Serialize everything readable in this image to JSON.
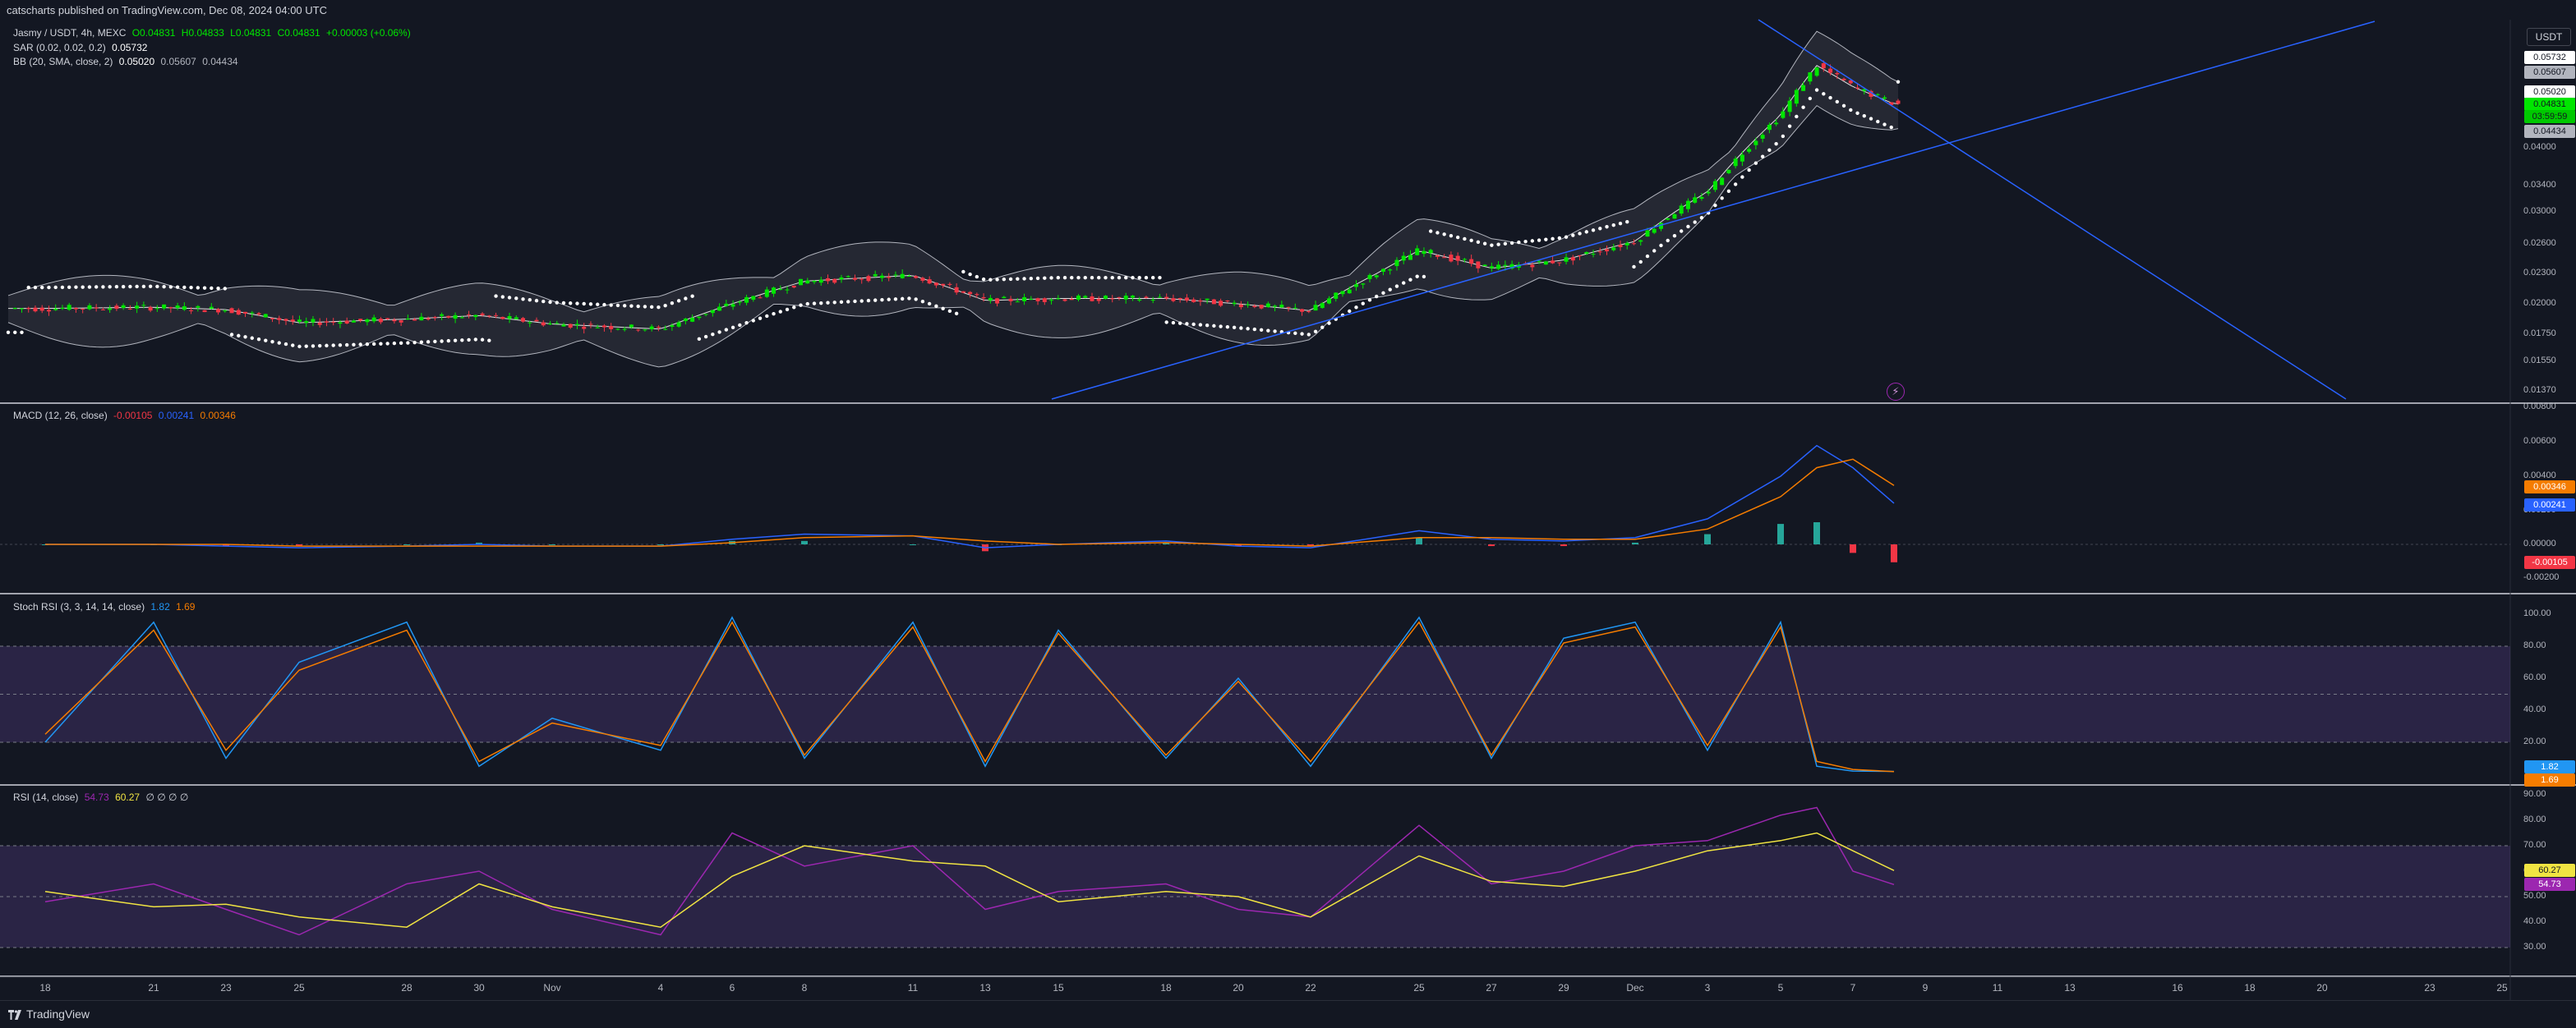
{
  "header": {
    "published": "catscharts published on TradingView.com, Dec 08, 2024 04:00 UTC"
  },
  "legend": {
    "main": {
      "symbol": "Jasmy / USDT, 4h, MEXC",
      "o": "O0.04831",
      "h": "H0.04833",
      "l": "L0.04831",
      "c": "C0.04831",
      "chg": "+0.00003 (+0.06%)"
    },
    "sar": {
      "name": "SAR (0.02, 0.02, 0.2)",
      "value": "0.05732"
    },
    "bb": {
      "name": "BB (20, SMA, close, 2)",
      "basis": "0.05020",
      "upper": "0.05607",
      "lower": "0.04434"
    },
    "macd": {
      "name": "MACD (12, 26, close)",
      "hist": "-0.00105",
      "macd": "0.00241",
      "signal": "0.00346"
    },
    "stoch": {
      "name": "Stoch RSI (3, 3, 14, 14, close)",
      "k": "1.82",
      "d": "1.69"
    },
    "rsi": {
      "name": "RSI (14, close)",
      "rsi": "54.73",
      "ma": "60.27",
      "extra": "∅ ∅ ∅ ∅"
    }
  },
  "axis": {
    "currency": "USDT",
    "price_ticks": [
      "0.04000",
      "0.03400",
      "0.03000",
      "0.02600",
      "0.02300",
      "0.02000",
      "0.01750",
      "0.01550",
      "0.01370"
    ],
    "price_tags": [
      {
        "text": "0.05732",
        "bg": "#ffffff",
        "fg": "#131722"
      },
      {
        "text": "0.05607",
        "bg": "#b2b5be",
        "fg": "#131722"
      },
      {
        "text": "0.05020",
        "bg": "#ffffff",
        "fg": "#131722"
      },
      {
        "text": "0.04831",
        "bg": "#00e600",
        "fg": "#131722"
      },
      {
        "text": "03:59:59",
        "bg": "#00c800",
        "fg": "#131722"
      },
      {
        "text": "0.04434",
        "bg": "#b2b5be",
        "fg": "#131722"
      }
    ],
    "macd_ticks": [
      "0.00800",
      "0.00600",
      "0.00400",
      "0.00200",
      "0.00000",
      "-0.00200"
    ],
    "macd_tags": [
      {
        "text": "0.00346",
        "bg": "#f57c00",
        "fg": "#ffffff"
      },
      {
        "text": "0.00241",
        "bg": "#2962ff",
        "fg": "#ffffff"
      },
      {
        "text": "-0.00105",
        "bg": "#f23645",
        "fg": "#ffffff"
      }
    ],
    "stoch_ticks": [
      "100.00",
      "80.00",
      "60.00",
      "40.00",
      "20.00"
    ],
    "stoch_tags": [
      {
        "text": "1.82",
        "bg": "#2196f3",
        "fg": "#ffffff"
      },
      {
        "text": "1.69",
        "bg": "#f57c00",
        "fg": "#ffffff"
      }
    ],
    "rsi_ticks": [
      "90.00",
      "80.00",
      "70.00",
      "60.00",
      "50.00",
      "40.00",
      "30.00"
    ],
    "rsi_tags": [
      {
        "text": "60.27",
        "bg": "#f0e442",
        "fg": "#131722"
      },
      {
        "text": "54.73",
        "bg": "#9c27b0",
        "fg": "#ffffff"
      }
    ],
    "x_labels": [
      "18",
      "21",
      "23",
      "25",
      "28",
      "30",
      "Nov",
      "4",
      "6",
      "8",
      "11",
      "13",
      "15",
      "18",
      "20",
      "22",
      "25",
      "27",
      "29",
      "Dec",
      "3",
      "5",
      "7",
      "9",
      "11",
      "13",
      "16",
      "18",
      "20",
      "23",
      "25"
    ]
  },
  "footer": {
    "brand": "TradingView"
  },
  "colors": {
    "up": "#00e600",
    "down": "#f23645",
    "macd": "#2962ff",
    "signal": "#f57c00",
    "stochK": "#2196f3",
    "stochD": "#f57c00",
    "rsi": "#9c27b0",
    "rsiMa": "#f0e442",
    "trend": "#2962ff"
  },
  "chart_data": [
    {
      "type": "candlestick",
      "title": "Jasmy / USDT, 4h, MEXC",
      "x": [
        "Oct 18",
        "Oct 21",
        "Oct 23",
        "Oct 25",
        "Oct 28",
        "Oct 30",
        "Nov 1",
        "Nov 4",
        "Nov 6",
        "Nov 8",
        "Nov 11",
        "Nov 13",
        "Nov 15",
        "Nov 18",
        "Nov 20",
        "Nov 22",
        "Nov 25",
        "Nov 27",
        "Nov 29",
        "Dec 1",
        "Dec 3",
        "Dec 5",
        "Dec 6",
        "Dec 7",
        "Dec 8"
      ],
      "close": [
        0.0196,
        0.0197,
        0.0195,
        0.0184,
        0.0187,
        0.019,
        0.0183,
        0.0179,
        0.02,
        0.0222,
        0.0228,
        0.0203,
        0.0205,
        0.0205,
        0.02,
        0.0194,
        0.0253,
        0.0235,
        0.0243,
        0.0263,
        0.033,
        0.046,
        0.057,
        0.052,
        0.0483
      ],
      "bb_upper_last": 0.05607,
      "bb_basis_last": 0.0502,
      "bb_lower_last": 0.04434,
      "sar_last": 0.05732,
      "ylim": [
        0.013,
        0.06
      ]
    },
    {
      "type": "line",
      "title": "MACD (12, 26, close)",
      "x": [
        "Oct 18",
        "Oct 21",
        "Oct 23",
        "Oct 25",
        "Oct 28",
        "Oct 30",
        "Nov 1",
        "Nov 4",
        "Nov 6",
        "Nov 8",
        "Nov 11",
        "Nov 13",
        "Nov 15",
        "Nov 18",
        "Nov 20",
        "Nov 22",
        "Nov 25",
        "Nov 27",
        "Nov 29",
        "Dec 1",
        "Dec 3",
        "Dec 5",
        "Dec 6",
        "Dec 7",
        "Dec 8"
      ],
      "series": [
        {
          "name": "MACD",
          "values": [
            0.0,
            0.0,
            -0.0001,
            -0.0002,
            -0.0001,
            0.0,
            -0.0001,
            -0.0001,
            0.0003,
            0.0006,
            0.0005,
            -0.0002,
            0.0,
            0.0002,
            -0.0001,
            -0.0002,
            0.0008,
            0.0003,
            0.0002,
            0.0004,
            0.0015,
            0.004,
            0.0058,
            0.0045,
            0.00241
          ]
        },
        {
          "name": "Signal",
          "values": [
            0.0,
            0.0,
            0.0,
            -0.0001,
            -0.0001,
            -0.0001,
            -0.0001,
            -0.0001,
            0.0001,
            0.0004,
            0.0005,
            0.0002,
            0.0,
            0.0001,
            0.0,
            -0.0001,
            0.0004,
            0.0004,
            0.0003,
            0.0003,
            0.0009,
            0.0028,
            0.0045,
            0.005,
            0.00346
          ]
        }
      ],
      "ylim": [
        -0.0025,
        0.008
      ]
    },
    {
      "type": "line",
      "title": "Stoch RSI (3, 3, 14, 14, close)",
      "x": [
        "Oct 18",
        "Oct 21",
        "Oct 23",
        "Oct 25",
        "Oct 28",
        "Oct 30",
        "Nov 1",
        "Nov 4",
        "Nov 6",
        "Nov 8",
        "Nov 11",
        "Nov 13",
        "Nov 15",
        "Nov 18",
        "Nov 20",
        "Nov 22",
        "Nov 25",
        "Nov 27",
        "Nov 29",
        "Dec 1",
        "Dec 3",
        "Dec 5",
        "Dec 6",
        "Dec 7",
        "Dec 8"
      ],
      "series": [
        {
          "name": "K",
          "values": [
            20,
            95,
            10,
            70,
            95,
            5,
            35,
            15,
            98,
            10,
            95,
            5,
            90,
            10,
            60,
            5,
            98,
            10,
            85,
            95,
            15,
            95,
            5,
            2,
            1.82
          ]
        },
        {
          "name": "D",
          "values": [
            25,
            90,
            15,
            65,
            90,
            8,
            32,
            18,
            95,
            12,
            92,
            8,
            88,
            12,
            58,
            8,
            95,
            12,
            82,
            92,
            18,
            92,
            8,
            3,
            1.69
          ]
        }
      ],
      "ylim": [
        0,
        100
      ]
    },
    {
      "type": "line",
      "title": "RSI (14, close)",
      "x": [
        "Oct 18",
        "Oct 21",
        "Oct 23",
        "Oct 25",
        "Oct 28",
        "Oct 30",
        "Nov 1",
        "Nov 4",
        "Nov 6",
        "Nov 8",
        "Nov 11",
        "Nov 13",
        "Nov 15",
        "Nov 18",
        "Nov 20",
        "Nov 22",
        "Nov 25",
        "Nov 27",
        "Nov 29",
        "Dec 1",
        "Dec 3",
        "Dec 5",
        "Dec 6",
        "Dec 7",
        "Dec 8"
      ],
      "series": [
        {
          "name": "RSI",
          "values": [
            48,
            55,
            45,
            35,
            55,
            60,
            45,
            35,
            75,
            62,
            70,
            45,
            52,
            55,
            45,
            42,
            78,
            55,
            60,
            70,
            72,
            82,
            85,
            60,
            54.73
          ]
        },
        {
          "name": "RSI MA",
          "values": [
            52,
            46,
            47,
            42,
            38,
            55,
            46,
            38,
            58,
            70,
            64,
            62,
            48,
            52,
            50,
            42,
            66,
            56,
            54,
            60,
            68,
            72,
            75,
            68,
            60.27
          ]
        }
      ],
      "ylim": [
        20,
        90
      ]
    }
  ]
}
